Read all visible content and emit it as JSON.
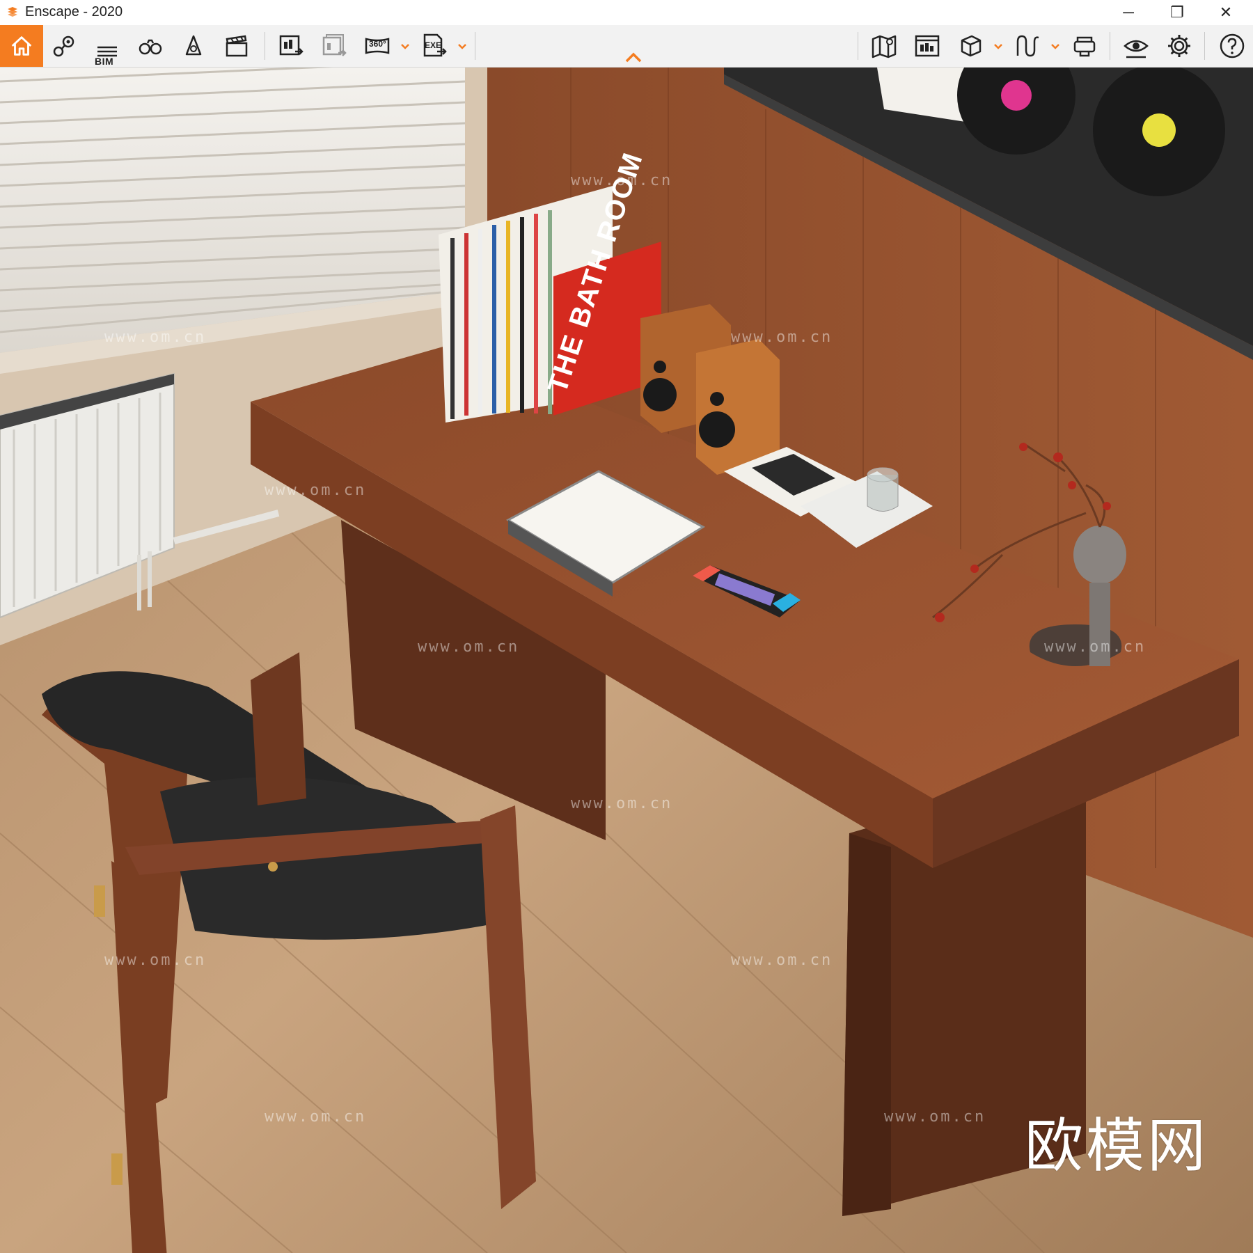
{
  "window": {
    "title": "Enscape - 2020",
    "controls": {
      "minimize": "─",
      "maximize": "❐",
      "close": "✕"
    }
  },
  "toolbar": {
    "bim_label": "BIM",
    "panorama_label": "360°",
    "exe_label": "EXE",
    "accent_color": "#f47c20",
    "buttons": [
      "home-icon",
      "location-pin-icon",
      "bim-list-icon",
      "binoculars-icon",
      "sun-icon",
      "clapperboard-icon",
      "render-image-icon",
      "batch-render-icon",
      "panorama-360-icon",
      "export-exe-icon",
      "map-icon",
      "asset-library-icon",
      "cube-view-icon",
      "material-editor-icon",
      "vr-headset-icon",
      "visual-settings-icon",
      "settings-gear-icon",
      "help-icon"
    ]
  },
  "viewport": {
    "watermark_main": "欧模网",
    "watermark_url": "www.om.cn",
    "book_spine_text": "THE BATH ROOM"
  }
}
